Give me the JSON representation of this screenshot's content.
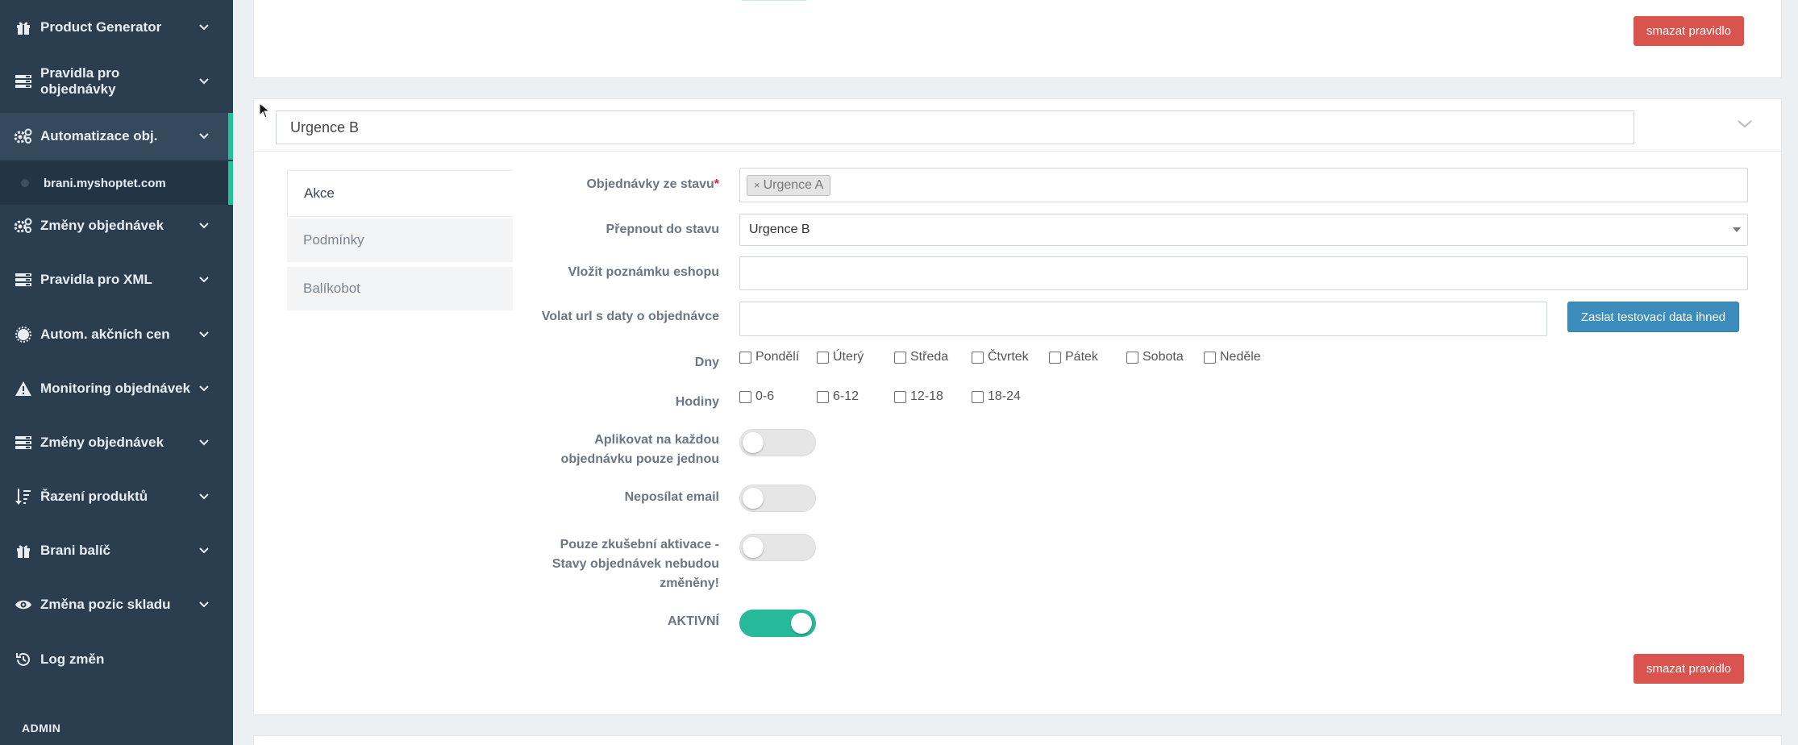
{
  "sidebar": {
    "items": [
      {
        "label": "Product Generator",
        "icon": "gift-icon"
      },
      {
        "label": "Pravidla pro objednávky",
        "icon": "server-icon"
      },
      {
        "label": "Automatizace obj.",
        "icon": "cogs-icon"
      },
      {
        "label": "Změny objednávek",
        "icon": "cogs-icon"
      },
      {
        "label": "Pravidla pro XML",
        "icon": "server-icon"
      },
      {
        "label": "Autom. akčních cen",
        "icon": "sun-icon"
      },
      {
        "label": "Monitoring objednávek",
        "icon": "warning-icon"
      },
      {
        "label": "Změny objednávek",
        "icon": "server-icon"
      },
      {
        "label": "Řazení produktů",
        "icon": "sort-icon"
      },
      {
        "label": "Brani balíč",
        "icon": "gift-icon"
      },
      {
        "label": "Změna pozic skladu",
        "icon": "eye-icon"
      },
      {
        "label": "Log změn",
        "icon": "history-icon"
      }
    ],
    "sub_item": "brani.myshoptet.com",
    "footer": "ADMIN"
  },
  "top_card": {
    "delete_label": "smazat pravidlo"
  },
  "rule": {
    "title": "Urgence B",
    "tabs": [
      "Akce",
      "Podmínky",
      "Balíkobot"
    ],
    "fields": {
      "from_state_label": "Objednávky ze stavu",
      "from_state_required": "*",
      "from_state_tag": "Urgence A",
      "from_state_tag_remove": "×",
      "switch_to_label": "Přepnout do stavu",
      "switch_to_value": "Urgence B",
      "note_label": "Vložit poznámku eshopu",
      "note_value": "",
      "url_label": "Volat url s daty o objednávce",
      "url_value": "",
      "send_test_label": "Zaslat testovací data ihned",
      "days_label": "Dny",
      "days": [
        "Pondělí",
        "Úterý",
        "Středa",
        "Čtvrtek",
        "Pátek",
        "Sobota",
        "Neděle"
      ],
      "hours_label": "Hodiny",
      "hours": [
        "0-6",
        "6-12",
        "12-18",
        "18-24"
      ],
      "apply_once_label_1": "Aplikovat na každou",
      "apply_once_label_2": "objednávku pouze jednou",
      "no_email_label": "Neposílat email",
      "test_activation_label_1": "Pouze zkušební aktivace -",
      "test_activation_label_2": "Stavy objednávek nebudou",
      "test_activation_label_3": "změněny!",
      "active_label": "AKTIVNÍ"
    },
    "toggles": {
      "apply_once": false,
      "no_email": false,
      "test_activation": false,
      "active": true
    },
    "delete_label": "smazat pravidlo"
  },
  "colors": {
    "sidebar_bg": "#2b3e4f",
    "accent": "#21c29a",
    "danger": "#d9534f",
    "primary": "#3c8dbc"
  }
}
